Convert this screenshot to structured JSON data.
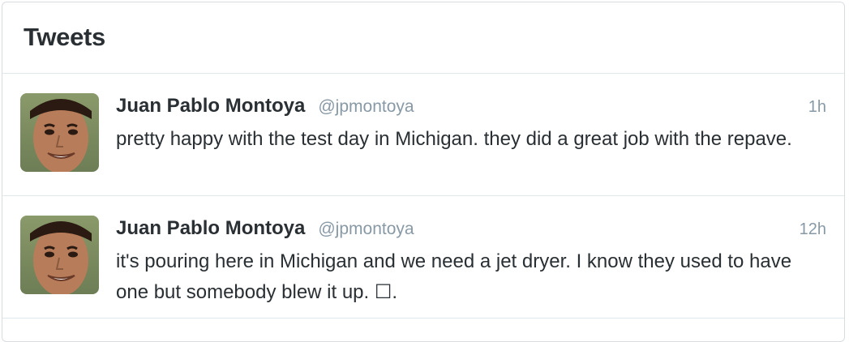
{
  "header": {
    "title": "Tweets"
  },
  "tweets": [
    {
      "fullname": "Juan Pablo Montoya",
      "username": "@jpmontoya",
      "time": "1h",
      "text": "pretty happy with the test day in Michigan. they did a great job with the repave."
    },
    {
      "fullname": "Juan Pablo Montoya",
      "username": "@jpmontoya",
      "time": "12h",
      "text": "it's pouring here in Michigan and we need a jet dryer. I know they used to have one but somebody blew it up. ☐."
    }
  ],
  "colors": {
    "text": "#292f33",
    "secondary": "#8899a6",
    "border": "#e1e8ed"
  }
}
